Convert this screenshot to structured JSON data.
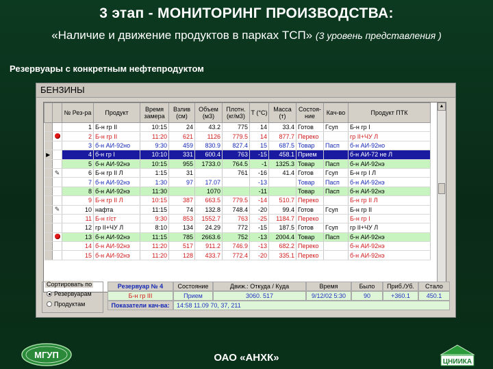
{
  "slide": {
    "title": "3 этап - МОНИТОРИНГ ПРОИЗВОДСТВА:",
    "subtitle": "«Наличие и движение продуктов в парках ТСП»",
    "subtitle_level": "(3 уровень представления )",
    "section_label": "Резервуары с конкретным нефтепродуктом",
    "footer": "ОАО «АНХК»",
    "logo_left_text": "МГУП",
    "logo_right_text": "ЦНИИКА"
  },
  "window": {
    "title": "БЕНЗИНЫ",
    "columns": [
      "№ Рез-ра",
      "Продукт",
      "Время замера",
      "Взлив (см)",
      "Объем (м3)",
      "Плотн. (кг/м3)",
      "Т (°С)",
      "Масса (т)",
      "Состоя-ние",
      "Кач-во",
      "Продукт ПТК"
    ],
    "rows": [
      {
        "no": "1",
        "product": "Б-н гр II",
        "time": "10:15",
        "level": "24",
        "volume": "43.2",
        "density": "775",
        "t": "14",
        "mass": "33.4",
        "state": "Готов",
        "quality": "Гсуп",
        "ptk": "Б-н гр I"
      },
      {
        "no": "2",
        "product": "Б-н гр II",
        "time": "11:20",
        "level": "621",
        "volume": "1126",
        "density": "779.5",
        "t": "14",
        "mass": "877.7",
        "state": "Переко",
        "quality": "",
        "ptk": "гр II+ЧУ Л"
      },
      {
        "no": "3",
        "product": "б-н АИ-92но",
        "time": "9:30",
        "level": "459",
        "volume": "830.9",
        "density": "827.4",
        "t": "15",
        "mass": "687.5",
        "state": "Товар",
        "quality": "Пасп",
        "ptk": "б-н АИ-92но"
      },
      {
        "no": "4",
        "product": "б-н гр I",
        "time": "10:10",
        "level": "331",
        "volume": "600.4",
        "density": "763",
        "t": "-15",
        "mass": "458.1",
        "state": "Прием",
        "quality": "",
        "ptk": "б-н АИ-72 не Л"
      },
      {
        "no": "5",
        "product": "б-н АИ-92нэ",
        "time": "10:15",
        "level": "955",
        "volume": "1733.0",
        "density": "764.5",
        "t": "-1",
        "mass": "1325.3",
        "state": "Товар",
        "quality": "Пасп",
        "ptk": "б-н АИ-92нэ"
      },
      {
        "no": "6",
        "product": "Б-н гр II Л",
        "time": "1:15",
        "level": "31",
        "volume": "",
        "density": "761",
        "t": "-16",
        "mass": "41.4",
        "state": "Готов",
        "quality": "Гсуп",
        "ptk": "Б-н гр I Л"
      },
      {
        "no": "7",
        "product": "б-н АИ-92нэ",
        "time": "1:30",
        "level": "97",
        "volume": "17.07",
        "density": "",
        "t": "-13",
        "mass": "",
        "state": "Товар",
        "quality": "Пасп",
        "ptk": "б-н АИ-92нэ"
      },
      {
        "no": "8",
        "product": "б-н АИ-92нэ",
        "time": "11:30",
        "level": "",
        "volume": "1070",
        "density": "",
        "t": "-11",
        "mass": "",
        "state": "Товар",
        "quality": "Пасп",
        "ptk": "б-н АИ-92нэ"
      },
      {
        "no": "9",
        "product": "Б-н гр II Л",
        "time": "10:15",
        "level": "387",
        "volume": "663.5",
        "density": "779.5",
        "t": "-14",
        "mass": "510.7",
        "state": "Переко",
        "quality": "",
        "ptk": "Б-н гр II Л"
      },
      {
        "no": "10",
        "product": "нафта",
        "time": "11:15",
        "level": "74",
        "volume": "132.8",
        "density": "748.4",
        "t": "-20",
        "mass": "99.4",
        "state": "Готов",
        "quality": "Гсуп",
        "ptk": "Б-н гр II"
      },
      {
        "no": "11",
        "product": "Б-н г/ст",
        "time": "9:30",
        "level": "853",
        "volume": "1552.7",
        "density": "763",
        "t": "-25",
        "mass": "1184.7",
        "state": "Переко",
        "quality": "",
        "ptk": "Б-н гр I"
      },
      {
        "no": "12",
        "product": "гр II+ЧУ Л",
        "time": "8:10",
        "level": "134",
        "volume": "24.29",
        "density": "772",
        "t": "-15",
        "mass": "187.5",
        "state": "Готов",
        "quality": "Гсуп",
        "ptk": "гр II+ЧУ Л"
      },
      {
        "no": "13",
        "product": "б-н АИ-92нэ",
        "time": "11:15",
        "level": "785",
        "volume": "2663.6",
        "density": "752",
        "t": "-13",
        "mass": "2004.4",
        "state": "Товар",
        "quality": "Пасп",
        "ptk": "б-н АИ-92нэ"
      },
      {
        "no": "14",
        "product": "б-н АИ-92нэ",
        "time": "11:20",
        "level": "517",
        "volume": "911.2",
        "density": "746.9",
        "t": "-13",
        "mass": "682.2",
        "state": "Переко",
        "quality": "",
        "ptk": "б-н АИ-92нэ"
      },
      {
        "no": "15",
        "product": "б-н АИ-92нэ",
        "time": "11:20",
        "level": "128",
        "volume": "433.7",
        "density": "772.4",
        "t": "-20",
        "mass": "335.1",
        "state": "Переко",
        "quality": "",
        "ptk": "б-н АИ-92нэ"
      }
    ],
    "sort": {
      "caption": "Сортировать по",
      "options": [
        "Резервуарам",
        "Продуктам"
      ],
      "selected": 0
    },
    "detail": {
      "tank_label": "Резервуар № 4",
      "product": "Б-н гр III",
      "state_header": "Состояние",
      "state_value": "Прием",
      "move_header": "Движ.: Откуда / Куда",
      "move_value": "3060. 517",
      "time_header": "Время",
      "time_value": "9/12/02 5:30",
      "was_header": "Было",
      "was_value": "90",
      "arrived_header": "Приб./Уб.",
      "arrived_value": "+360.1",
      "became_header": "Стало",
      "became_value": "450.1",
      "quality_label": "Показатели кач-ва:",
      "quality_value": "14:58 11.09 70, 37, 211"
    }
  },
  "colors": {
    "slide_background": "#0a2a18",
    "row_green": "#c8f4c0",
    "row_selected": "#1a1aa0",
    "text_red": "#d01818",
    "text_blue": "#1428b4"
  }
}
